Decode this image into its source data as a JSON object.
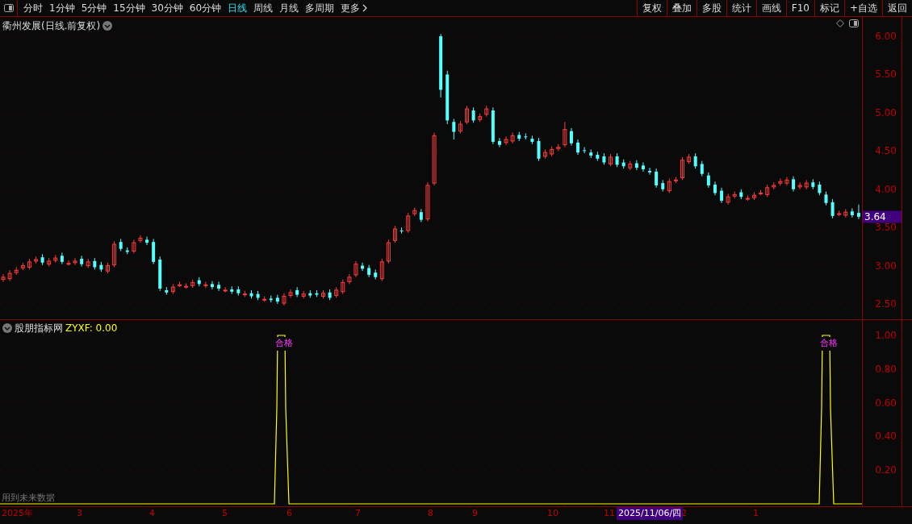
{
  "toolbar": {
    "periods": [
      {
        "label": "分时",
        "selected": false
      },
      {
        "label": "1分钟",
        "selected": false
      },
      {
        "label": "5分钟",
        "selected": false
      },
      {
        "label": "15分钟",
        "selected": false
      },
      {
        "label": "30分钟",
        "selected": false
      },
      {
        "label": "60分钟",
        "selected": false
      },
      {
        "label": "日线",
        "selected": true
      },
      {
        "label": "周线",
        "selected": false
      },
      {
        "label": "月线",
        "selected": false
      },
      {
        "label": "多周期",
        "selected": false
      }
    ],
    "more": "更多",
    "buttons": [
      "复权",
      "叠加",
      "多股",
      "统计",
      "画线",
      "F10",
      "标记",
      "+自选",
      "返回"
    ]
  },
  "main_chart": {
    "title": "衢州发展(日线.前复权)",
    "last_price": "3.64",
    "chart_data": {
      "type": "candlestick",
      "ylim": [
        2.5,
        6.0
      ],
      "grid": true,
      "yticks": [
        {
          "value": 6.0,
          "label": "6.00"
        },
        {
          "value": 5.5,
          "label": "5.50"
        },
        {
          "value": 5.0,
          "label": "5.00"
        },
        {
          "value": 4.5,
          "label": "4.50"
        },
        {
          "value": 4.0,
          "label": "4.00"
        },
        {
          "value": 3.5,
          "label": "3.50"
        },
        {
          "value": 3.0,
          "label": "3.00"
        },
        {
          "value": 2.5,
          "label": "2.50"
        }
      ],
      "ohlc": [
        [
          2.82,
          2.89,
          2.79,
          2.85
        ],
        [
          2.83,
          2.94,
          2.8,
          2.9
        ],
        [
          2.91,
          2.98,
          2.88,
          2.94
        ],
        [
          2.97,
          3.04,
          2.94,
          3.0
        ],
        [
          2.98,
          3.09,
          2.95,
          3.05
        ],
        [
          3.06,
          3.12,
          3.03,
          3.08
        ],
        [
          3.11,
          3.15,
          3.01,
          3.04
        ],
        [
          3.02,
          3.1,
          2.99,
          3.06
        ],
        [
          3.07,
          3.14,
          3.04,
          3.1
        ],
        [
          3.13,
          3.17,
          3.02,
          3.05
        ],
        [
          3.03,
          3.07,
          3.0,
          3.03
        ],
        [
          3.04,
          3.1,
          3.01,
          3.06
        ],
        [
          3.09,
          3.13,
          2.99,
          3.02
        ],
        [
          3.0,
          3.09,
          2.97,
          3.05
        ],
        [
          3.06,
          3.1,
          2.95,
          2.98
        ],
        [
          3.01,
          3.05,
          2.92,
          2.95
        ],
        [
          2.93,
          3.04,
          2.9,
          3.0
        ],
        [
          3.01,
          3.32,
          2.98,
          3.28
        ],
        [
          3.31,
          3.35,
          3.19,
          3.22
        ],
        [
          3.2,
          3.24,
          3.15,
          3.18
        ],
        [
          3.19,
          3.34,
          3.16,
          3.3
        ],
        [
          3.33,
          3.4,
          3.3,
          3.36
        ],
        [
          3.34,
          3.38,
          3.27,
          3.3
        ],
        [
          3.31,
          3.35,
          3.02,
          3.05
        ],
        [
          3.08,
          3.12,
          2.67,
          2.7
        ],
        [
          2.68,
          2.72,
          2.62,
          2.65
        ],
        [
          2.66,
          2.76,
          2.63,
          2.72
        ],
        [
          2.75,
          2.79,
          2.72,
          2.75
        ],
        [
          2.73,
          2.77,
          2.7,
          2.73
        ],
        [
          2.74,
          2.82,
          2.71,
          2.78
        ],
        [
          2.81,
          2.85,
          2.73,
          2.76
        ],
        [
          2.74,
          2.79,
          2.71,
          2.75
        ],
        [
          2.76,
          2.8,
          2.69,
          2.72
        ],
        [
          2.75,
          2.79,
          2.67,
          2.7
        ],
        [
          2.68,
          2.72,
          2.65,
          2.68
        ],
        [
          2.69,
          2.73,
          2.63,
          2.66
        ],
        [
          2.69,
          2.73,
          2.61,
          2.64
        ],
        [
          2.62,
          2.67,
          2.59,
          2.63
        ],
        [
          2.64,
          2.68,
          2.57,
          2.6
        ],
        [
          2.63,
          2.67,
          2.55,
          2.58
        ],
        [
          2.56,
          2.6,
          2.53,
          2.56
        ],
        [
          2.57,
          2.61,
          2.52,
          2.55
        ],
        [
          2.58,
          2.62,
          2.5,
          2.53
        ],
        [
          2.51,
          2.64,
          2.48,
          2.6
        ],
        [
          2.61,
          2.69,
          2.58,
          2.65
        ],
        [
          2.68,
          2.72,
          2.59,
          2.62
        ],
        [
          2.6,
          2.67,
          2.57,
          2.63
        ],
        [
          2.64,
          2.68,
          2.58,
          2.61
        ],
        [
          2.64,
          2.68,
          2.59,
          2.62
        ],
        [
          2.6,
          2.68,
          2.57,
          2.64
        ],
        [
          2.65,
          2.69,
          2.55,
          2.58
        ],
        [
          2.61,
          2.72,
          2.58,
          2.68
        ],
        [
          2.66,
          2.82,
          2.63,
          2.78
        ],
        [
          2.79,
          2.89,
          2.76,
          2.85
        ],
        [
          2.88,
          3.06,
          2.85,
          3.02
        ],
        [
          3.0,
          3.04,
          2.93,
          2.96
        ],
        [
          2.97,
          3.01,
          2.85,
          2.88
        ],
        [
          2.91,
          2.95,
          2.82,
          2.85
        ],
        [
          2.83,
          3.09,
          2.8,
          3.05
        ],
        [
          3.06,
          3.34,
          3.03,
          3.3
        ],
        [
          3.33,
          3.52,
          3.3,
          3.48
        ],
        [
          3.46,
          3.5,
          3.42,
          3.45
        ],
        [
          3.46,
          3.69,
          3.43,
          3.65
        ],
        [
          3.68,
          3.76,
          3.65,
          3.72
        ],
        [
          3.7,
          3.74,
          3.57,
          3.6
        ],
        [
          3.61,
          4.09,
          3.58,
          4.05
        ],
        [
          4.08,
          4.74,
          4.05,
          4.7
        ],
        [
          6.0,
          6.03,
          5.2,
          5.3
        ],
        [
          5.5,
          5.55,
          4.85,
          4.9
        ],
        [
          4.88,
          4.92,
          4.65,
          4.75
        ],
        [
          4.76,
          4.89,
          4.73,
          4.85
        ],
        [
          4.88,
          5.09,
          4.85,
          5.05
        ],
        [
          5.03,
          5.07,
          4.87,
          4.9
        ],
        [
          4.91,
          4.99,
          4.88,
          4.95
        ],
        [
          4.98,
          5.09,
          4.95,
          5.05
        ],
        [
          5.03,
          5.07,
          4.59,
          4.62
        ],
        [
          4.63,
          4.67,
          4.55,
          4.58
        ],
        [
          4.61,
          4.69,
          4.58,
          4.65
        ],
        [
          4.63,
          4.74,
          4.6,
          4.7
        ],
        [
          4.71,
          4.75,
          4.63,
          4.66
        ],
        [
          4.69,
          4.73,
          4.65,
          4.68
        ],
        [
          4.66,
          4.7,
          4.59,
          4.62
        ],
        [
          4.63,
          4.67,
          4.37,
          4.4
        ],
        [
          4.43,
          4.52,
          4.4,
          4.48
        ],
        [
          4.46,
          4.56,
          4.43,
          4.52
        ],
        [
          4.53,
          4.59,
          4.5,
          4.55
        ],
        [
          4.58,
          4.88,
          4.55,
          4.78
        ],
        [
          4.76,
          4.8,
          4.57,
          4.6
        ],
        [
          4.61,
          4.65,
          4.45,
          4.48
        ],
        [
          4.51,
          4.55,
          4.47,
          4.5
        ],
        [
          4.48,
          4.52,
          4.41,
          4.44
        ],
        [
          4.45,
          4.49,
          4.37,
          4.4
        ],
        [
          4.43,
          4.47,
          4.32,
          4.35
        ],
        [
          4.33,
          4.46,
          4.3,
          4.42
        ],
        [
          4.43,
          4.47,
          4.29,
          4.32
        ],
        [
          4.35,
          4.39,
          4.27,
          4.3
        ],
        [
          4.28,
          4.37,
          4.25,
          4.33
        ],
        [
          4.34,
          4.38,
          4.25,
          4.28
        ],
        [
          4.31,
          4.35,
          4.23,
          4.26
        ],
        [
          4.24,
          4.28,
          4.19,
          4.22
        ],
        [
          4.23,
          4.27,
          4.02,
          4.05
        ],
        [
          4.08,
          4.12,
          3.97,
          4.0
        ],
        [
          3.98,
          4.14,
          3.95,
          4.1
        ],
        [
          4.11,
          4.16,
          4.08,
          4.12
        ],
        [
          4.15,
          4.42,
          4.12,
          4.38
        ],
        [
          4.36,
          4.46,
          4.33,
          4.42
        ],
        [
          4.43,
          4.47,
          4.27,
          4.3
        ],
        [
          4.33,
          4.37,
          4.17,
          4.2
        ],
        [
          4.18,
          4.22,
          4.02,
          4.05
        ],
        [
          4.06,
          4.1,
          3.92,
          3.95
        ],
        [
          3.98,
          4.02,
          3.82,
          3.85
        ],
        [
          3.83,
          3.94,
          3.8,
          3.9
        ],
        [
          3.91,
          3.97,
          3.88,
          3.93
        ],
        [
          3.96,
          4.0,
          3.87,
          3.9
        ],
        [
          3.88,
          3.92,
          3.85,
          3.88
        ],
        [
          3.89,
          3.96,
          3.86,
          3.92
        ],
        [
          3.95,
          3.99,
          3.92,
          3.95
        ],
        [
          3.93,
          4.06,
          3.9,
          4.02
        ],
        [
          4.03,
          4.09,
          4.0,
          4.05
        ],
        [
          4.08,
          4.14,
          4.05,
          4.1
        ],
        [
          4.08,
          4.16,
          4.05,
          4.12
        ],
        [
          4.13,
          4.17,
          3.97,
          4.0
        ],
        [
          4.03,
          4.09,
          4.0,
          4.05
        ],
        [
          4.03,
          4.12,
          4.0,
          4.08
        ],
        [
          4.09,
          4.13,
          4.0,
          4.03
        ],
        [
          4.06,
          4.1,
          3.92,
          3.95
        ],
        [
          3.93,
          3.97,
          3.79,
          3.82
        ],
        [
          3.83,
          3.87,
          3.62,
          3.65
        ],
        [
          3.68,
          3.72,
          3.65,
          3.68
        ],
        [
          3.66,
          3.74,
          3.63,
          3.7
        ],
        [
          3.71,
          3.75,
          3.63,
          3.66
        ],
        [
          3.69,
          3.8,
          3.61,
          3.64
        ]
      ]
    }
  },
  "indicator": {
    "name": "股朋指标网",
    "reading": "ZYXF: 0.00",
    "signal_labels": [
      "合格",
      "合格"
    ],
    "axis": [
      "1.00",
      "0.80",
      "0.60",
      "0.40",
      "0.20"
    ],
    "note": "用到未来数据"
  },
  "date_axis": {
    "labels": [
      "2025年",
      "3",
      "4",
      "5",
      "6",
      "7",
      "8",
      "9",
      "10",
      "11",
      "2",
      "1"
    ],
    "cursor_date": "2025/11/06/四"
  }
}
